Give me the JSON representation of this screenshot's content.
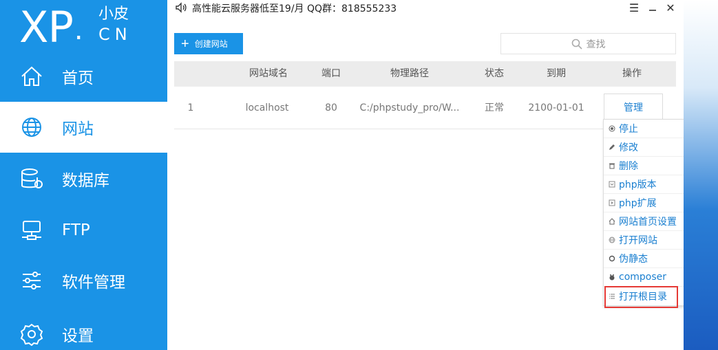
{
  "logo": {
    "main": "XP",
    "dot": ".",
    "top_right": "小皮",
    "bottom_right": "CN"
  },
  "sidebar": {
    "items": [
      {
        "label": "首页",
        "icon": "home-icon"
      },
      {
        "label": "网站",
        "icon": "globe-icon",
        "active": true
      },
      {
        "label": "数据库",
        "icon": "database-icon"
      },
      {
        "label": "FTP",
        "icon": "ftp-icon"
      },
      {
        "label": "软件管理",
        "icon": "sliders-icon"
      },
      {
        "label": "设置",
        "icon": "gear-icon"
      }
    ]
  },
  "titlebar": {
    "ad_text": "高性能云服务器低至19/月  QQ群：818555233",
    "menu_glyph": "☰",
    "close_glyph": "✕"
  },
  "toolbar": {
    "create_label": "创建网站",
    "plus_glyph": "+",
    "search_placeholder": "查找"
  },
  "table": {
    "headers": [
      "网站域名",
      "端口",
      "物理路径",
      "状态",
      "到期",
      "操作"
    ],
    "rows": [
      {
        "index": "1",
        "domain": "localhost",
        "port": "80",
        "path": "C:/phpstudy_pro/W...",
        "status": "正常",
        "expiry": "2100-01-01",
        "action": "管理"
      }
    ]
  },
  "menu": {
    "items": [
      {
        "label": "停止",
        "icon": "stop-icon"
      },
      {
        "label": "修改",
        "icon": "edit-icon"
      },
      {
        "label": "删除",
        "icon": "trash-icon"
      },
      {
        "label": "php版本",
        "icon": "php-version-icon",
        "submenu": true
      },
      {
        "label": "php扩展",
        "icon": "php-extension-icon",
        "submenu": true
      },
      {
        "label": "网站首页设置",
        "icon": "home-small-icon"
      },
      {
        "label": "打开网站",
        "icon": "globe-small-icon"
      },
      {
        "label": "伪静态",
        "icon": "rewrite-icon"
      },
      {
        "label": "composer",
        "icon": "composer-icon"
      },
      {
        "label": "打开根目录",
        "icon": "list-icon",
        "highlighted": true
      }
    ]
  },
  "colors": {
    "primary": "#1a93e6",
    "highlight": "#e53935",
    "link": "#1a7fd0"
  }
}
